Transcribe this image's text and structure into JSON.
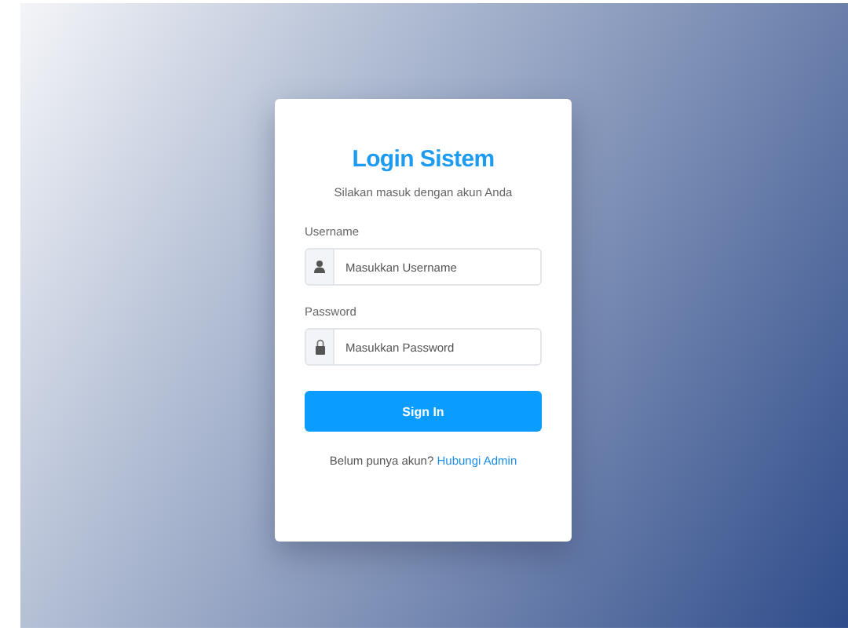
{
  "login": {
    "title": "Login Sistem",
    "subtitle": "Silakan masuk dengan akun Anda",
    "fields": [
      {
        "label": "Username",
        "placeholder": "Masukkan Username",
        "kind": "user"
      },
      {
        "label": "Password",
        "placeholder": "Masukkan Password",
        "kind": "lock"
      }
    ],
    "button": "Sign In",
    "footer": {
      "text": "Belum punya akun?",
      "link": "Hubungi Admin"
    }
  }
}
